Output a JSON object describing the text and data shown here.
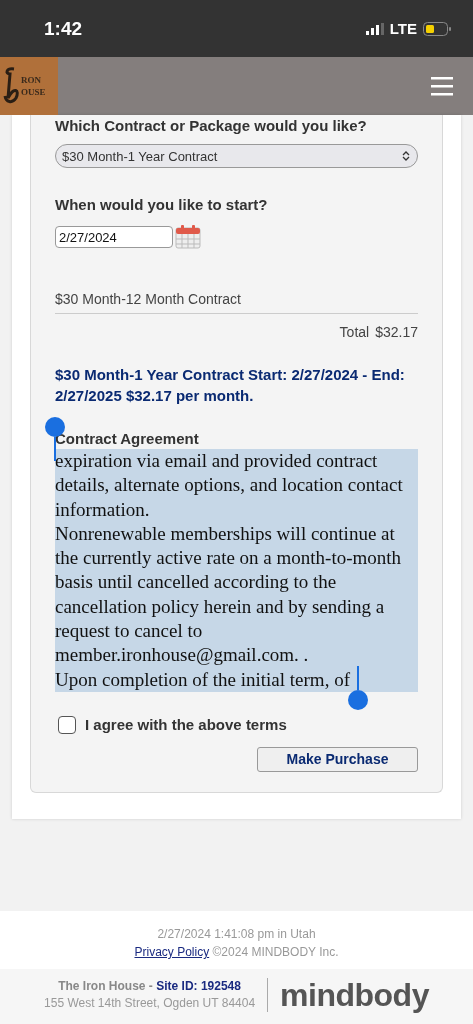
{
  "status_bar": {
    "time": "1:42",
    "network": "LTE"
  },
  "header": {
    "logo_lines": [
      "RON",
      "OUSE"
    ]
  },
  "form": {
    "package_question": "Which Contract or Package would you like?",
    "package_select": {
      "value": "$30 Month-1 Year Contract"
    },
    "start_question": "When would you like to start?",
    "start_date": {
      "value": "2/27/2024"
    },
    "line_item": "$30 Month-12 Month Contract",
    "total_label": "Total",
    "total_value": "$32.17",
    "summary": "$30 Month-1 Year Contract Start: 2/27/2024 - End: 2/27/2025 $32.17 per month.",
    "agreement_title": "Contract Agreement",
    "agreement": {
      "selected": true,
      "paragraphs": [
        "expiration via email and provided contract details, alternate options, and location contact information.",
        "Nonrenewable memberships will continue at the currently active rate on a month-to-month basis until cancelled according to the cancellation policy herein and by sending a request to cancel to member.ironhouse@gmail.com. .",
        "Upon completion of the initial term, of"
      ]
    },
    "agree": {
      "label": "I agree with the above terms",
      "checked": false
    },
    "purchase_button": "Make Purchase"
  },
  "footer": {
    "timestamp": "2/27/2024 1:41:08 pm in Utah",
    "privacy_link": "Privacy Policy",
    "copyright": "©2024 MINDBODY Inc.",
    "business_name": "The Iron House -",
    "site_id_link": "Site ID: 192548",
    "address": "155 West 14th Street, Ogden UT 84404",
    "brand": "mindbody"
  }
}
